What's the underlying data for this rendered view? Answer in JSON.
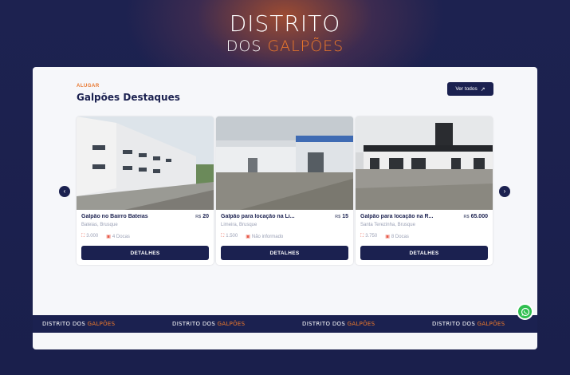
{
  "brand": {
    "line1": "DISTRITO",
    "line2_a": "DOS ",
    "line2_b": "GALPÕES"
  },
  "section": {
    "kicker": "ALUGAR",
    "title": "Galpões Destaques",
    "view_all": "Ver todos"
  },
  "cards": [
    {
      "name": "Galpão no Bairro Bateias",
      "currency": "R$",
      "price": "20",
      "location": "Bateias, Brusque",
      "area": "3.000",
      "docks": "4 Docas",
      "button": "DETALHES"
    },
    {
      "name": "Galpão para locação na Li...",
      "currency": "R$",
      "price": "15",
      "location": "Limeira, Brusque",
      "area": "1.500",
      "docks": "Não informado",
      "button": "DETALHES"
    },
    {
      "name": "Galpão para locação na R...",
      "currency": "R$",
      "price": "65.000",
      "location": "Santa Terezinha, Brusque",
      "area": "3.750",
      "docks": "8 Docas",
      "button": "DETALHES"
    }
  ],
  "ticker": [
    {
      "a": "DISTRITO DOS ",
      "b": "GALPÕES"
    },
    {
      "a": "DISTRITO DOS ",
      "b": "GALPÕES"
    },
    {
      "a": "DISTRITO DOS ",
      "b": "GALPÕES"
    },
    {
      "a": "DISTRITO DOS ",
      "b": "GALPÕES"
    }
  ],
  "colors": {
    "navy": "#1b2150",
    "accent": "#f07a2a",
    "whatsapp": "#2fbf4f"
  },
  "icons": {
    "prev": "chevron-left-icon",
    "next": "chevron-right-icon",
    "chat": "whatsapp-icon"
  }
}
